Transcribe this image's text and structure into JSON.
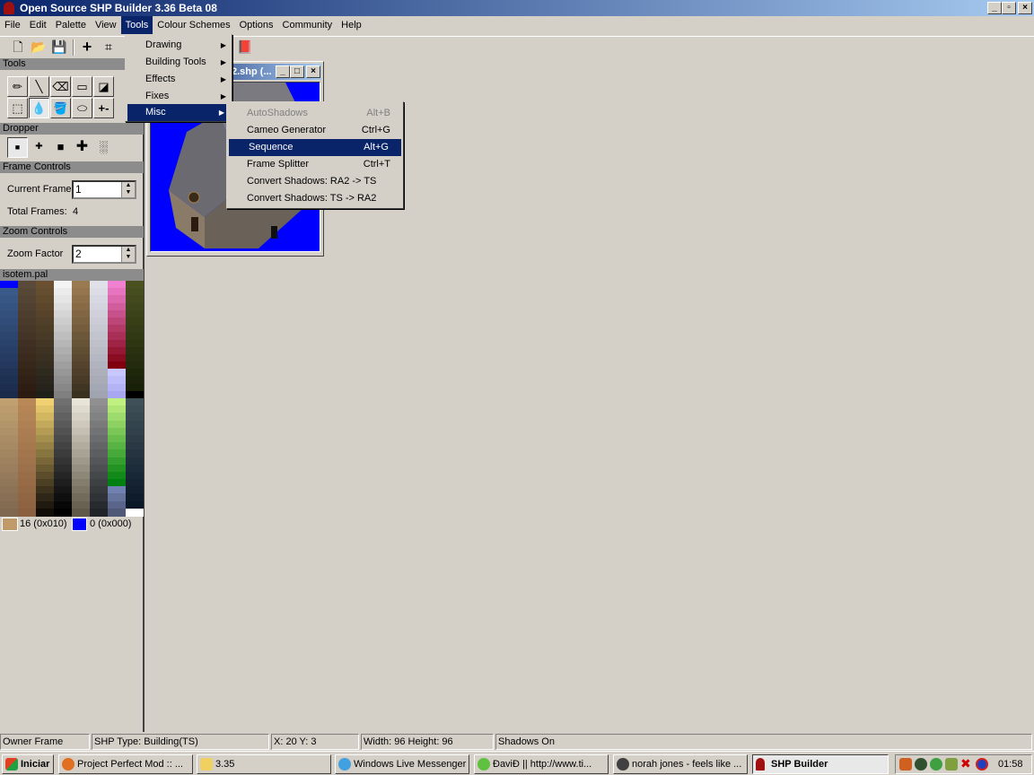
{
  "window": {
    "title": "Open Source SHP Builder 3.36 Beta 08",
    "controls": [
      "_",
      "▫",
      "×"
    ]
  },
  "menubar": [
    "File",
    "Edit",
    "Palette",
    "View",
    "Tools",
    "Colour Schemes",
    "Options",
    "Community",
    "Help"
  ],
  "tools_menu": {
    "items": [
      {
        "label": "Drawing"
      },
      {
        "label": "Building Tools"
      },
      {
        "label": "Effects"
      },
      {
        "label": "Fixes"
      },
      {
        "label": "Misc",
        "highlighted": true
      }
    ]
  },
  "misc_submenu": {
    "items": [
      {
        "label": "AutoShadows",
        "shortcut": "Alt+B",
        "disabled": true
      },
      {
        "label": "Cameo Generator",
        "shortcut": "Ctrl+G"
      },
      {
        "label": "Sequence",
        "shortcut": "Alt+G",
        "highlighted": true
      },
      {
        "label": "Frame Splitter",
        "shortcut": "Ctrl+T"
      },
      {
        "label": "Convert Shadows: RA2 -> TS",
        "shortcut": ""
      },
      {
        "label": "Convert Shadows: TS -> RA2",
        "shortcut": ""
      }
    ]
  },
  "panel": {
    "tools_header": "Tools",
    "dropper_header": "Dropper",
    "frame_header": "Frame Controls",
    "current_frame_label": "Current Frame",
    "current_frame": "1",
    "total_frames_label": "Total Frames:",
    "total_frames": "4",
    "zoom_header": "Zoom Controls",
    "zoom_label": "Zoom Factor",
    "zoom": "2",
    "palette_name": "isotem.pal",
    "primary_color": {
      "label": "16 (0x010)",
      "hex": "#c09a68"
    },
    "secondary_color": {
      "label": "0 (0x000)",
      "hex": "#0000ff"
    }
  },
  "child_window": {
    "title": "2.shp (...",
    "background": "#0000ff"
  },
  "palette_columns": [
    [
      [
        "#0000ff",
        "#0000ff",
        1
      ],
      [
        "#3a5a8a",
        "#1a2a4a",
        15
      ]
    ],
    [
      [
        "#5a4a3a",
        "#2a1a10",
        16
      ]
    ],
    [
      [
        "#6a5030",
        "#20201a",
        16
      ]
    ],
    [
      [
        "#f4f4f4",
        "#808080",
        16
      ]
    ],
    [
      [
        "#9a7a50",
        "#3a3020",
        16
      ]
    ],
    [
      [
        "#e0e0e8",
        "#a0a4b0",
        16
      ]
    ],
    [
      [
        "#f080d0",
        "#800010",
        12
      ],
      [
        "#c8c8ff",
        "#a8a8f0",
        4
      ]
    ],
    [
      [
        "#4a5020",
        "#182008",
        15
      ],
      [
        "#000000",
        "#000000",
        1
      ]
    ],
    [
      [
        "#c0a070",
        "#806850",
        16
      ]
    ],
    [
      [
        "#b88858",
        "#8a6040",
        16
      ]
    ],
    [
      [
        "#f0d070",
        "#100c08",
        16
      ]
    ],
    [
      [
        "#707070",
        "#000000",
        16
      ]
    ],
    [
      [
        "#e8e4d8",
        "#605848",
        16
      ]
    ],
    [
      [
        "#909090",
        "#202428",
        16
      ]
    ],
    [
      [
        "#c0f080",
        "#008010",
        12
      ],
      [
        "#7080b0",
        "#505878",
        4
      ]
    ],
    [
      [
        "#405058",
        "#0a1828",
        15
      ],
      [
        "#ffffff",
        "#ffffff",
        1
      ]
    ]
  ],
  "statusbar": [
    "Owner Frame",
    "SHP Type: Building(TS)",
    "X: 20 Y: 3",
    "Width: 96 Height: 96",
    "Shadows On"
  ],
  "taskbar": {
    "start": "Iniciar",
    "tasks": [
      "Project Perfect Mod :: ...",
      "3.35",
      "Windows Live Messenger",
      "ĐaviĐ || http://www.ti...",
      "norah jones - feels like ...",
      "SHP Builder"
    ],
    "clock": "01:58"
  }
}
